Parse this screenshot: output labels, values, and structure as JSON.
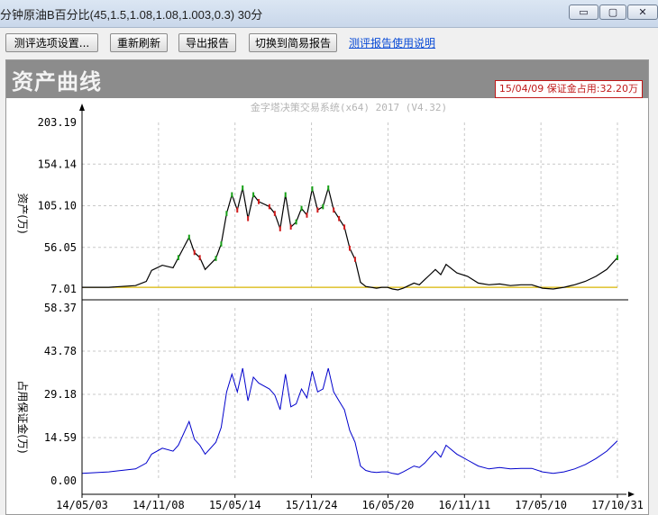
{
  "window": {
    "title": "分钟原油B百分比(45,1.5,1.08,1.08,1.003,0.3) 30分",
    "min_glyph": "▭",
    "max_glyph": "▢",
    "close_glyph": "✕"
  },
  "toolbar": {
    "settings_label": "测评选项设置...",
    "refresh_label": "重新刷新",
    "export_label": "导出报告",
    "simple_label": "切换到简易报告",
    "help_link": "测评报告使用说明"
  },
  "banner": {
    "title": "资产曲线",
    "margin_badge": "15/04/09 保证金占用:32.20万"
  },
  "watermark": "金字塔决策交易系统(x64) 2017 (V4.32)",
  "colors": {
    "asset_line": "#000000",
    "up_bar": "#16a016",
    "down_bar": "#d11c1c",
    "base_line": "#d9b500",
    "margin_line": "#0000cc",
    "grid": "#c8c8c8"
  },
  "chart_data": [
    {
      "type": "line",
      "ylabel": "资产(万)",
      "y_ticks": [
        "203.19",
        "154.14",
        "105.10",
        "56.05",
        "7.01"
      ],
      "ylim": [
        7.01,
        203.19
      ],
      "x_ticks": [
        "14/05/03",
        "14/11/08",
        "15/05/14",
        "15/11/24",
        "16/05/20",
        "16/11/11",
        "17/05/10",
        "17/10/31"
      ],
      "x": [
        0,
        0.05,
        0.1,
        0.12,
        0.13,
        0.15,
        0.17,
        0.18,
        0.2,
        0.21,
        0.22,
        0.23,
        0.25,
        0.26,
        0.27,
        0.28,
        0.29,
        0.3,
        0.31,
        0.32,
        0.33,
        0.35,
        0.36,
        0.37,
        0.38,
        0.39,
        0.4,
        0.41,
        0.42,
        0.43,
        0.44,
        0.45,
        0.46,
        0.47,
        0.48,
        0.49,
        0.5,
        0.51,
        0.52,
        0.53,
        0.54,
        0.55,
        0.56,
        0.57,
        0.58,
        0.59,
        0.6,
        0.62,
        0.63,
        0.64,
        0.65,
        0.66,
        0.67,
        0.68,
        0.7,
        0.72,
        0.74,
        0.76,
        0.78,
        0.8,
        0.82,
        0.84,
        0.86,
        0.88,
        0.9,
        0.92,
        0.94,
        0.96,
        0.98,
        1.0
      ],
      "values": [
        9,
        9,
        11,
        16,
        29,
        35,
        32,
        44,
        68,
        50,
        44,
        30,
        43,
        60,
        96,
        118,
        100,
        126,
        90,
        118,
        110,
        104,
        96,
        78,
        118,
        80,
        86,
        102,
        94,
        125,
        100,
        104,
        126,
        100,
        90,
        80,
        55,
        42,
        15,
        10,
        9,
        8,
        9,
        9,
        7,
        6,
        8,
        14,
        12,
        18,
        24,
        30,
        24,
        36,
        26,
        22,
        14,
        12,
        13,
        11,
        12,
        12,
        8,
        7,
        9,
        12,
        16,
        22,
        30,
        44
      ],
      "base_value": 9
    },
    {
      "type": "line",
      "ylabel": "占用保证金(万)",
      "y_ticks": [
        "58.37",
        "43.78",
        "29.18",
        "14.59",
        "0.00"
      ],
      "ylim": [
        0,
        58.37
      ],
      "x_ticks": [
        "14/05/03",
        "14/11/08",
        "15/05/14",
        "15/11/24",
        "16/05/20",
        "16/11/11",
        "17/05/10",
        "17/10/31"
      ],
      "x": [
        0,
        0.05,
        0.1,
        0.12,
        0.13,
        0.15,
        0.17,
        0.18,
        0.2,
        0.21,
        0.22,
        0.23,
        0.25,
        0.26,
        0.27,
        0.28,
        0.29,
        0.3,
        0.31,
        0.32,
        0.33,
        0.35,
        0.36,
        0.37,
        0.38,
        0.39,
        0.4,
        0.41,
        0.42,
        0.43,
        0.44,
        0.45,
        0.46,
        0.47,
        0.48,
        0.49,
        0.5,
        0.51,
        0.52,
        0.53,
        0.54,
        0.55,
        0.56,
        0.57,
        0.58,
        0.59,
        0.6,
        0.62,
        0.63,
        0.64,
        0.65,
        0.66,
        0.67,
        0.68,
        0.7,
        0.72,
        0.74,
        0.76,
        0.78,
        0.8,
        0.82,
        0.84,
        0.86,
        0.88,
        0.9,
        0.92,
        0.94,
        0.96,
        0.98,
        1.0
      ],
      "values": [
        2.5,
        3,
        4,
        6,
        9,
        11,
        10,
        12,
        20,
        14,
        12,
        9,
        13,
        18,
        30,
        36,
        30,
        38,
        27,
        35,
        33,
        31,
        29,
        24,
        36,
        25,
        26,
        31,
        28,
        37,
        30,
        31,
        38,
        30,
        27,
        24,
        17,
        13,
        5,
        3.5,
        3,
        2.8,
        3,
        3,
        2.5,
        2.2,
        3,
        5,
        4.5,
        6,
        8,
        10,
        8,
        12,
        9,
        7,
        5,
        4,
        4.5,
        4,
        4.2,
        4.2,
        3,
        2.5,
        3,
        4,
        5.5,
        7.5,
        10,
        13.5
      ]
    }
  ]
}
